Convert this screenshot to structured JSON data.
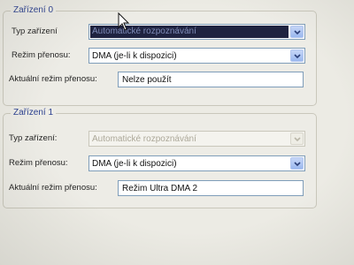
{
  "device0": {
    "legend": "Zařízení 0",
    "type_label": "Typ zařízení",
    "type_value": "Automatické rozpoznávání",
    "mode_label": "Režim přenosu:",
    "mode_value": "DMA (je-li k dispozici)",
    "current_label": "Aktuální režim přenosu:",
    "current_value": "Nelze použít"
  },
  "device1": {
    "legend": "Zařízení 1",
    "type_label": "Typ zařízení:",
    "type_value": "Automatické rozpoznávání",
    "mode_label": "Režim přenosu:",
    "mode_value": "DMA (je-li k dispozici)",
    "current_label": "Aktuální režim přenosu:",
    "current_value": "Režim Ultra DMA 2"
  },
  "colors": {
    "legend": "#2a3f8f",
    "selection": "#1f2340",
    "combo_border": "#7f9db9"
  },
  "icons": {
    "dropdown": "chevron-down-icon",
    "pointer": "mouse-pointer-icon"
  }
}
